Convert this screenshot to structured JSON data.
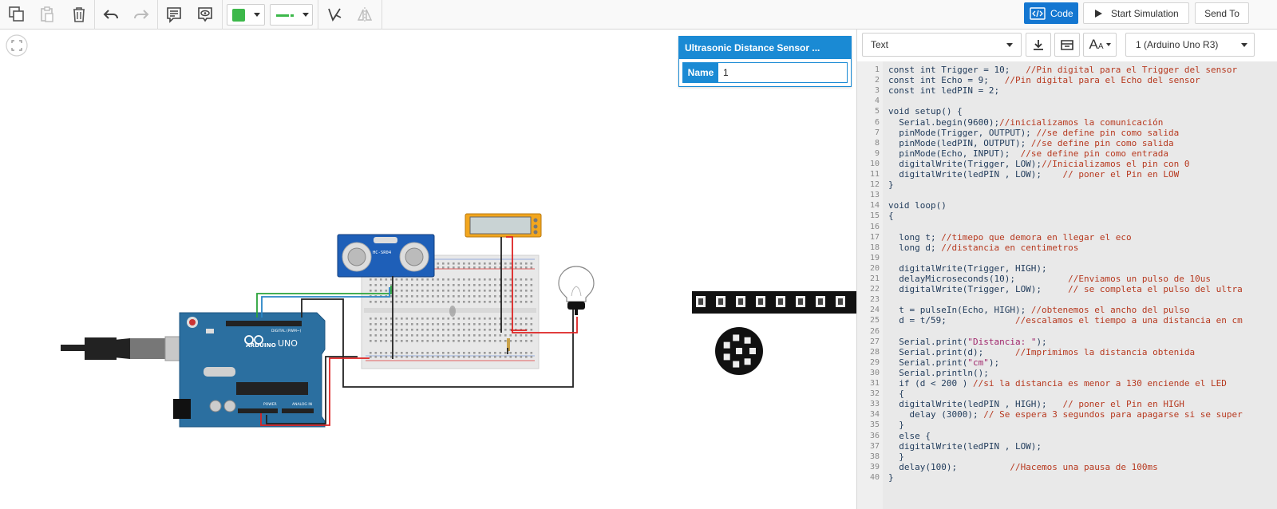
{
  "toolbar": {
    "code_label": "Code",
    "start_simulation_label": "Start Simulation",
    "send_to_label": "Send To",
    "fill_color": "#3cb84a",
    "line_color": "#3cb84a",
    "icons": [
      "copy-icon",
      "paste-icon",
      "trash-icon",
      "undo-icon",
      "redo-icon",
      "notes-icon",
      "view-icon",
      "flip-icon",
      "mirror-icon"
    ]
  },
  "inspector": {
    "title": "Ultrasonic Distance Sensor ...",
    "name_label": "Name",
    "name_value": "1"
  },
  "canvas": {
    "sensor_label": "HC-SR04",
    "arduino_label": "UNO",
    "arduino_brand": "ARDUINO",
    "digital_label": "DIGITAL (PWM~)",
    "power_label": "POWER",
    "analog_label": "ANALOG IN"
  },
  "code_panel": {
    "mode": "Text",
    "board": "1 (Arduino Uno R3)",
    "font_size_glyph": "A",
    "lines": [
      [
        "const int Trigger = 10;   ",
        "//Pin digital para el Trigger del sensor"
      ],
      [
        "const int Echo = 9;   ",
        "//Pin digital para el Echo del sensor"
      ],
      [
        "const int ledPIN = 2;",
        ""
      ],
      [
        "",
        ""
      ],
      [
        "void setup() {",
        ""
      ],
      [
        "  Serial.begin(9600);",
        "//inicializamos la comunicación"
      ],
      [
        "  pinMode(Trigger, OUTPUT); ",
        "//se define pin como salida"
      ],
      [
        "  pinMode(ledPIN, OUTPUT); ",
        "//se define pin como salida"
      ],
      [
        "  pinMode(Echo, INPUT);  ",
        "//se define pin como entrada"
      ],
      [
        "  digitalWrite(Trigger, LOW);",
        "//Inicializamos el pin con 0"
      ],
      [
        "  digitalWrite(ledPIN , LOW);    ",
        "// poner el Pin en LOW"
      ],
      [
        "}",
        ""
      ],
      [
        "",
        ""
      ],
      [
        "void loop()",
        ""
      ],
      [
        "{",
        ""
      ],
      [
        "",
        ""
      ],
      [
        "  long t; ",
        "//timepo que demora en llegar el eco"
      ],
      [
        "  long d; ",
        "//distancia en centimetros"
      ],
      [
        "",
        ""
      ],
      [
        "  digitalWrite(Trigger, HIGH);",
        ""
      ],
      [
        "  delayMicroseconds(10);          ",
        "//Enviamos un pulso de 10us"
      ],
      [
        "  digitalWrite(Trigger, LOW);     ",
        "// se completa el pulso del ultra"
      ],
      [
        "",
        ""
      ],
      [
        "  t = pulseIn(Echo, HIGH); ",
        "//obtenemos el ancho del pulso"
      ],
      [
        "  d = t/59;             ",
        "//escalamos el tiempo a una distancia en cm"
      ],
      [
        "",
        ""
      ],
      [
        "  Serial.print(\"Distancia: \");",
        ""
      ],
      [
        "  Serial.print(d);      ",
        "//Imprimimos la distancia obtenida"
      ],
      [
        "  Serial.print(\"cm\");",
        ""
      ],
      [
        "  Serial.println();",
        ""
      ],
      [
        "  if (d < 200 ) ",
        "//si la distancia es menor a 130 enciende el LED"
      ],
      [
        "  {",
        ""
      ],
      [
        "  digitalWrite(ledPIN , HIGH);   ",
        "// poner el Pin en HIGH"
      ],
      [
        "    delay (3000); ",
        "// Se espera 3 segundos para apagarse si se super"
      ],
      [
        "  }",
        ""
      ],
      [
        "  else {",
        ""
      ],
      [
        "  digitalWrite(ledPIN , LOW);",
        ""
      ],
      [
        "  }",
        ""
      ],
      [
        "  delay(100);          ",
        "//Hacemos una pausa de 100ms"
      ],
      [
        "}",
        ""
      ]
    ]
  }
}
